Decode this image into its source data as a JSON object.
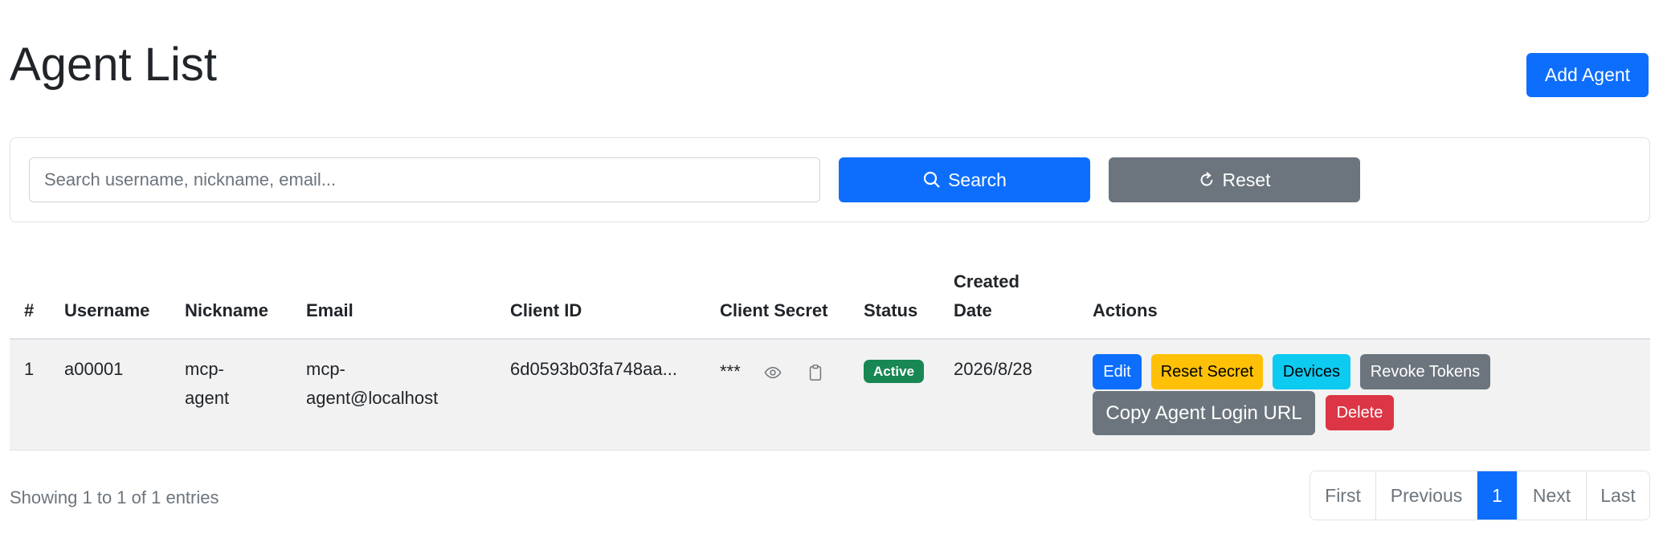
{
  "page": {
    "title": "Agent List",
    "add_button": "Add Agent"
  },
  "search": {
    "placeholder": "Search username, nickname, email...",
    "value": "",
    "search_button": "Search",
    "reset_button": "Reset"
  },
  "table": {
    "headers": {
      "index": "#",
      "username": "Username",
      "nickname": "Nickname",
      "email": "Email",
      "client_id": "Client ID",
      "client_secret": "Client Secret",
      "status": "Status",
      "created_date_line1": "Created",
      "created_date_line2": "Date",
      "actions": "Actions"
    },
    "rows": [
      {
        "index": "1",
        "username": "a00001",
        "nickname_line1": "mcp-",
        "nickname_line2": "agent",
        "email_line1": "mcp-",
        "email_line2": "agent@localhost",
        "client_id": "6d0593b03fa748aa...",
        "client_secret": "***",
        "status": "Active",
        "created_date": "2026/8/28",
        "actions": {
          "edit": "Edit",
          "reset_secret": "Reset Secret",
          "devices": "Devices",
          "revoke_tokens": "Revoke Tokens",
          "copy_login_url": "Copy Agent Login URL",
          "delete": "Delete"
        }
      }
    ]
  },
  "footer": {
    "showing": "Showing 1 to 1 of 1 entries",
    "pagination": {
      "first": "First",
      "previous": "Previous",
      "current": "1",
      "next": "Next",
      "last": "Last"
    }
  },
  "colors": {
    "primary": "#0d6efd",
    "secondary": "#6c757d",
    "warning": "#ffc107",
    "info": "#0dcaf0",
    "danger": "#dc3545",
    "success": "#198754"
  },
  "icons": {
    "search": "search-icon",
    "reset": "refresh-icon",
    "show_secret": "eye-icon",
    "copy_secret": "clipboard-icon"
  }
}
